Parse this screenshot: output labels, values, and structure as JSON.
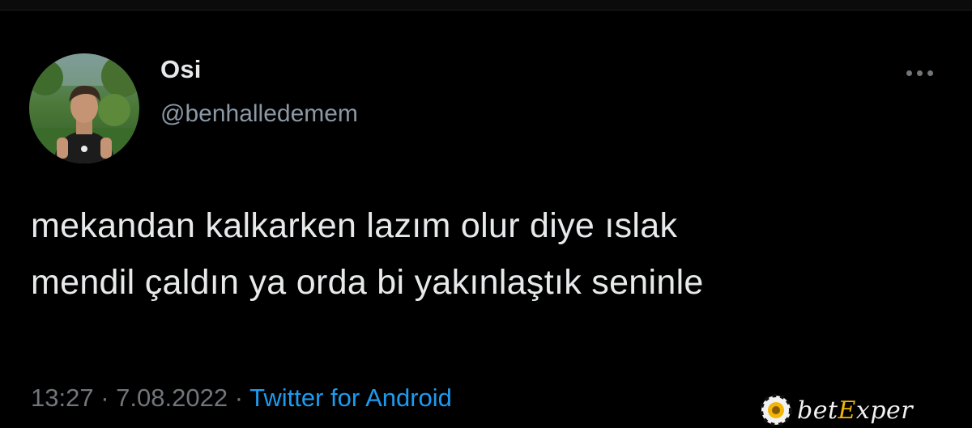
{
  "tweet": {
    "display_name": "Osi",
    "handle": "@benhalledemem",
    "text_line1": "mekandan kalkarken lazım olur diye ıslak",
    "text_line2": "mendil çaldın ya orda bi yakınlaştık seninle",
    "time": "13:27",
    "separator": "·",
    "date": "7.08.2022",
    "source": "Twitter for Android"
  },
  "icons": {
    "more": "more-dots-icon",
    "avatar": "profile-photo"
  },
  "watermark": {
    "prefix": "bet",
    "accent_letter": "E",
    "suffix": "xper",
    "accent_color": "#f2b705"
  },
  "colors": {
    "background": "#000000",
    "primary_text": "#e7e9ea",
    "secondary_text": "#71767b",
    "link": "#1d9bf0"
  }
}
